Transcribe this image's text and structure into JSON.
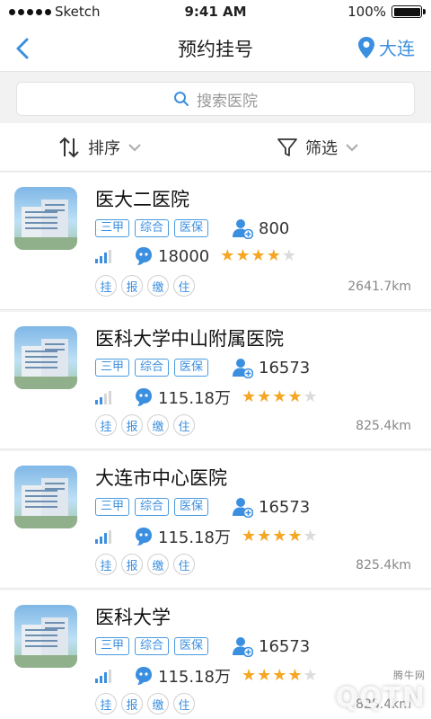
{
  "status_bar": {
    "carrier": "Sketch",
    "time": "9:41 AM",
    "battery": "100%"
  },
  "nav": {
    "title": "预约挂号",
    "location": "大连"
  },
  "search": {
    "placeholder": "搜索医院"
  },
  "toolbar": {
    "sort_label": "排序",
    "filter_label": "筛选"
  },
  "hospitals": [
    {
      "name": "医大二医院",
      "tags": [
        "三甲",
        "综合",
        "医保"
      ],
      "users": "800",
      "consults": "18000",
      "rating": 4,
      "signal": 3,
      "services": [
        "挂",
        "报",
        "缴",
        "住"
      ],
      "distance": "2641.7km"
    },
    {
      "name": "医科大学中山附属医院",
      "tags": [
        "三甲",
        "综合",
        "医保"
      ],
      "users": "16573",
      "consults": "115.18万",
      "rating": 4,
      "signal": 2,
      "services": [
        "挂",
        "报",
        "缴",
        "住"
      ],
      "distance": "825.4km"
    },
    {
      "name": "大连市中心医院",
      "tags": [
        "三甲",
        "综合",
        "医保"
      ],
      "users": "16573",
      "consults": "115.18万",
      "rating": 4,
      "signal": 3,
      "services": [
        "挂",
        "报",
        "缴",
        "住"
      ],
      "distance": "825.4km"
    },
    {
      "name": "医科大学",
      "tags": [
        "三甲",
        "综合",
        "医保"
      ],
      "users": "16573",
      "consults": "115.18万",
      "rating": 4,
      "signal": 3,
      "services": [
        "挂",
        "报",
        "缴",
        "住"
      ],
      "distance": "825.4km"
    }
  ],
  "watermark": {
    "text": "QQTN",
    "sub": "腾牛网"
  },
  "colors": {
    "accent": "#3b8fe0",
    "star": "#f5a623"
  }
}
